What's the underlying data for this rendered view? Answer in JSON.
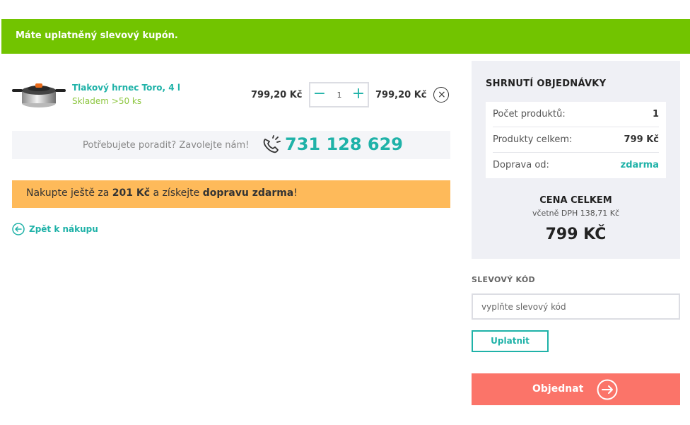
{
  "banner": {
    "text": "Máte uplatněný slevový kupón."
  },
  "cart": {
    "item": {
      "name": "Tlakový hrnec Toro, 4 l",
      "stock": "Skladem >50 ks",
      "unit_price": "799,20 Kč",
      "quantity": "1",
      "total_price": "799,20 Kč",
      "remove_symbol": "×",
      "minus_symbol": "−",
      "plus_symbol": "+"
    }
  },
  "help": {
    "text": "Potřebujete poradit? Zavolejte nám!",
    "phone": "731 128 629",
    "icon": "phone-icon"
  },
  "shipping_notice": {
    "prefix": "Nakupte ještě za ",
    "amount": "201 Kč",
    "middle": " a získejte ",
    "highlight": "dopravu zdarma",
    "suffix": "!"
  },
  "back_link": {
    "label": "Zpět k nákupu",
    "icon": "arrow-left-circle-icon"
  },
  "summary": {
    "title": "SHRNUTÍ OBJEDNÁVKY",
    "rows": [
      {
        "label": "Počet produktů:",
        "value": "1"
      },
      {
        "label": "Produkty celkem:",
        "value": "799 Kč"
      },
      {
        "label": "Doprava od:",
        "value": "zdarma"
      }
    ],
    "total_label": "CENA CELKEM",
    "total_vat": "včetně DPH 138,71 Kč",
    "total_value": "799 KČ"
  },
  "discount": {
    "label": "SLEVOVÝ KÓD",
    "placeholder": "vyplňte slevový kód",
    "apply_label": "Uplatnit"
  },
  "order": {
    "label": "Objednat",
    "icon": "arrow-right-circle-icon"
  },
  "colors": {
    "banner": "#72c400",
    "accent": "#1fb2a8",
    "notice": "#feba5a",
    "order_button": "#fb7469"
  }
}
